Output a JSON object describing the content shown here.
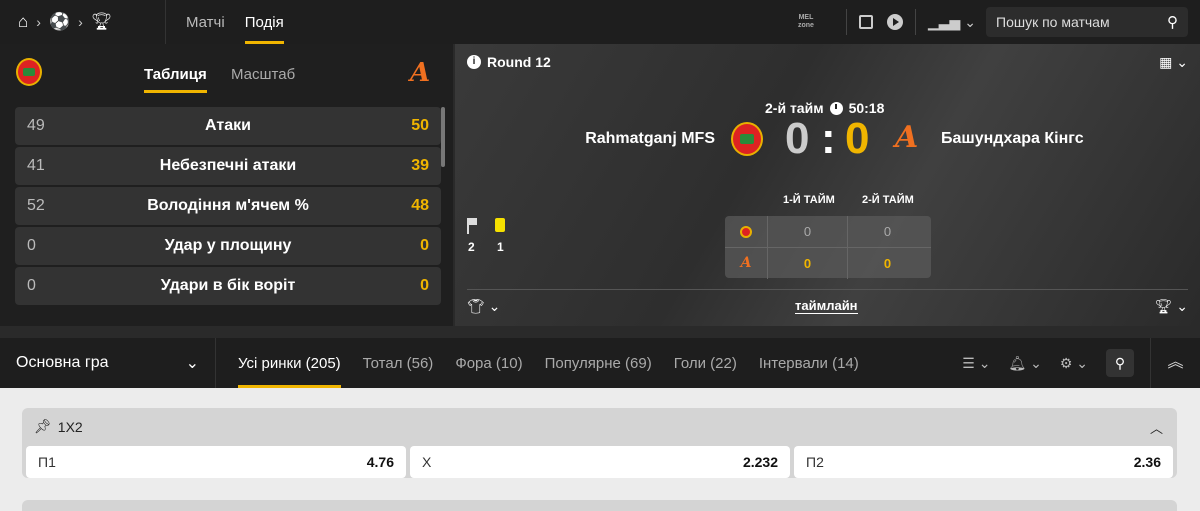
{
  "topbar": {
    "tabs": [
      {
        "label": "Матчі",
        "active": false
      },
      {
        "label": "Подія",
        "active": true
      }
    ],
    "mel_label": "MEL zone",
    "search_placeholder": "Пошук по матчам"
  },
  "stats_panel": {
    "tabs": [
      {
        "label": "Таблиця",
        "active": true
      },
      {
        "label": "Масштаб",
        "active": false
      }
    ],
    "rows": [
      {
        "left": "49",
        "name": "Атаки",
        "right": "50"
      },
      {
        "left": "41",
        "name": "Небезпечні атаки",
        "right": "39"
      },
      {
        "left": "52",
        "name": "Володіння м'ячем %",
        "right": "48"
      },
      {
        "left": "0",
        "name": "Удар у площину",
        "right": "0"
      },
      {
        "left": "0",
        "name": "Удари в бік воріт",
        "right": "0"
      }
    ]
  },
  "scoreboard": {
    "round": "Round 12",
    "period": "2-й тайм",
    "time": "50:18",
    "team1": "Rahmatganj MFS",
    "team2": "Башундхара Кінгс",
    "score1": "0",
    "score2": "0",
    "corners": "2",
    "yellow_cards": "1",
    "half_headers": [
      "1-Й ТАЙМ",
      "2-Й ТАЙМ"
    ],
    "halves": {
      "team1": [
        "0",
        "0"
      ],
      "team2": [
        "0",
        "0"
      ]
    },
    "timeline_label": "таймлайн"
  },
  "markets": {
    "dropdown_label": "Основна гра",
    "tabs": [
      {
        "label": "Усі ринки (205)",
        "active": true
      },
      {
        "label": "Тотал (56)",
        "active": false
      },
      {
        "label": "Фора (10)",
        "active": false
      },
      {
        "label": "Популярне (69)",
        "active": false
      },
      {
        "label": "Голи (22)",
        "active": false
      },
      {
        "label": "Інтервали (14)",
        "active": false
      }
    ]
  },
  "odds": {
    "market_title": "1X2",
    "outcomes": [
      {
        "label": "П1",
        "value": "4.76"
      },
      {
        "label": "X",
        "value": "2.232"
      },
      {
        "label": "П2",
        "value": "2.36"
      }
    ]
  },
  "colors": {
    "accent": "#f0b500",
    "team2_logo": "#f07020"
  }
}
